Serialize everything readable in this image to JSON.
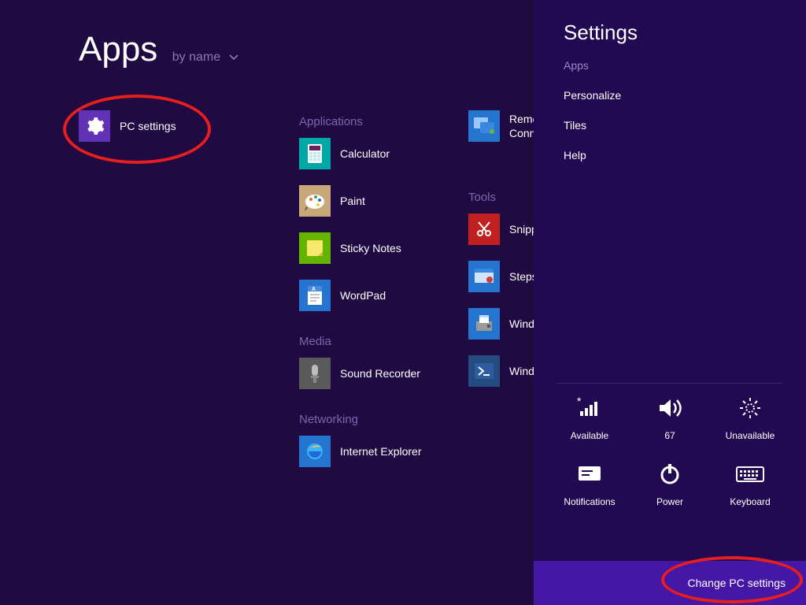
{
  "header": {
    "title": "Apps",
    "sort_label": "by name"
  },
  "groups": {
    "applications": "Applications",
    "media": "Media",
    "networking": "Networking",
    "tools": "Tools"
  },
  "apps": {
    "pc_settings": "PC settings",
    "calculator": "Calculator",
    "paint": "Paint",
    "sticky_notes": "Sticky Notes",
    "wordpad": "WordPad",
    "sound_recorder": "Sound Recorder",
    "internet_explorer": "Internet Explorer",
    "remote_desktop": "Remote Desktop Connection",
    "snipping_tool": "Snipping Tool",
    "steps_recorder": "Steps Recorder",
    "fax_scan": "Windows Fax and Scan",
    "powershell": "Windows PowerShell"
  },
  "settings_panel": {
    "title": "Settings",
    "links": {
      "apps": "Apps",
      "personalize": "Personalize",
      "tiles": "Tiles",
      "help": "Help"
    },
    "quick": {
      "network": "Available",
      "volume": "67",
      "brightness": "Unavailable",
      "notifications": "Notifications",
      "power": "Power",
      "keyboard": "Keyboard"
    },
    "change_pc": "Change PC settings"
  }
}
